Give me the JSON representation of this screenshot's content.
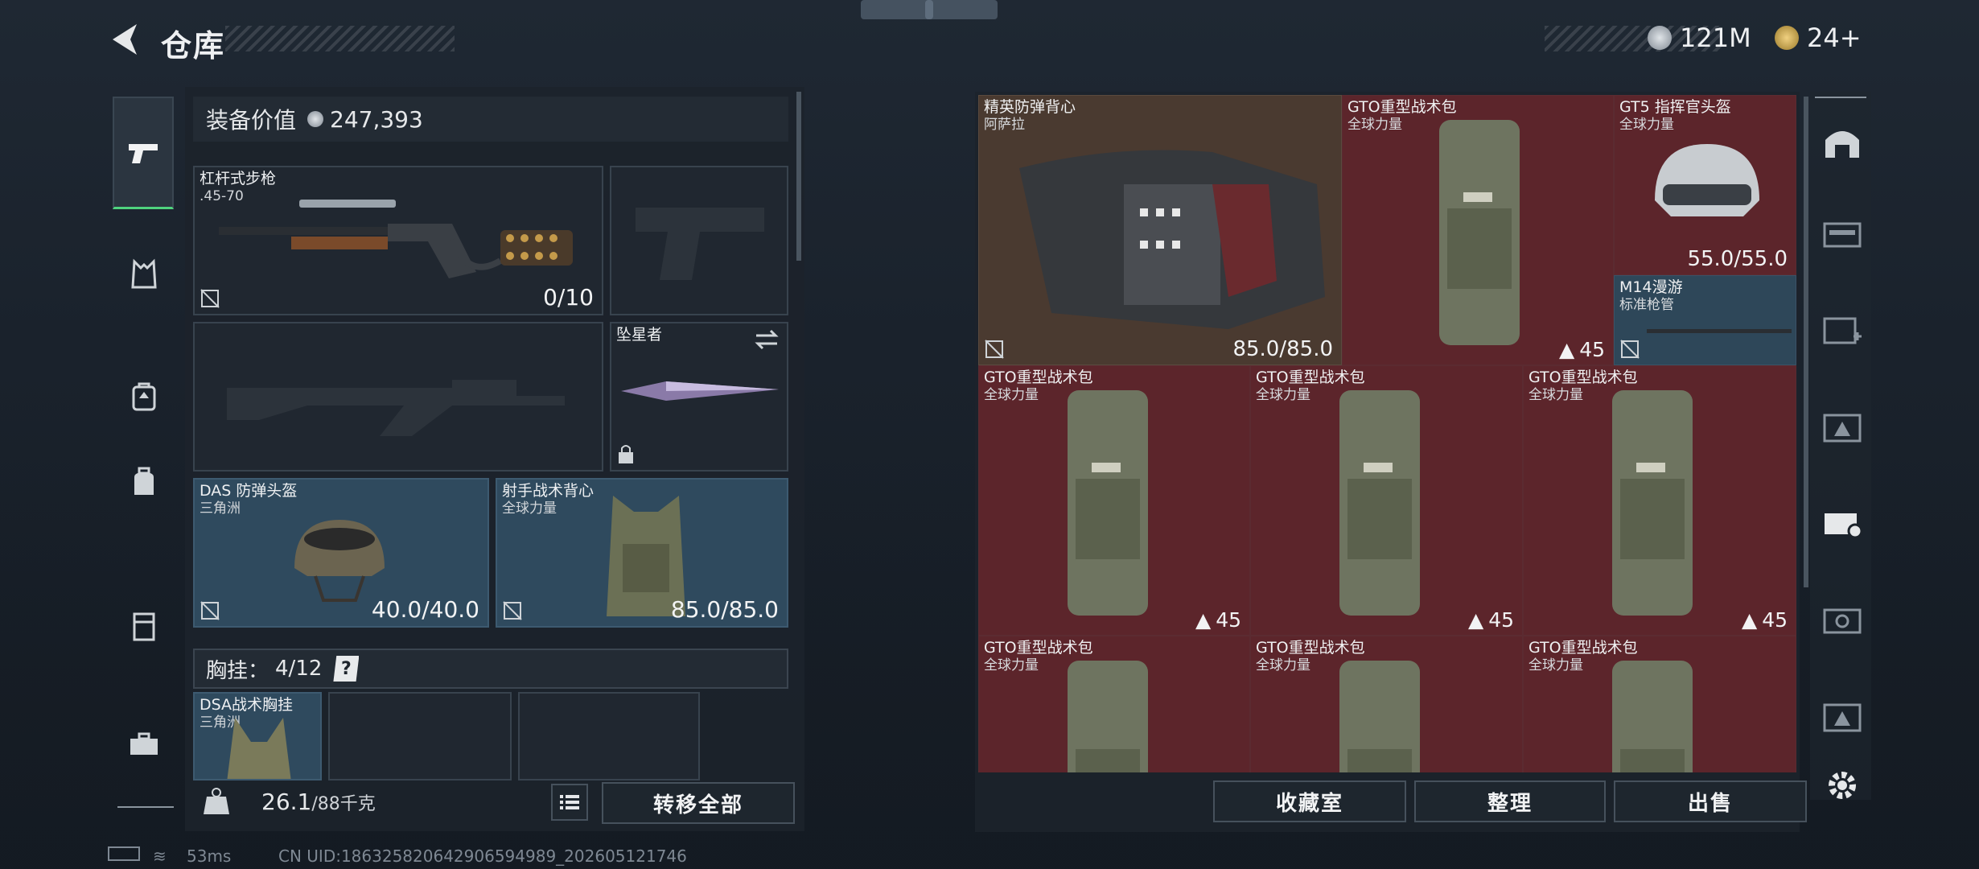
{
  "header": {
    "title": "仓库"
  },
  "currency": [
    {
      "value": "121M",
      "color": "#b8bfc7"
    },
    {
      "value": "24+",
      "color": "#c9a24a"
    }
  ],
  "left": {
    "equip_value_label": "装备价值",
    "equip_value": "247,393",
    "primary_weapon": {
      "name": "杠杆式步枪",
      "caliber": ".45-70",
      "ammo": "0/10"
    },
    "melee": {
      "name": "坠星者"
    },
    "helmet": {
      "name": "DAS 防弹头盔",
      "faction": "三角洲",
      "durability": "40.0/40.0"
    },
    "armor": {
      "name": "射手战术背心",
      "faction": "全球力量",
      "durability": "85.0/85.0"
    },
    "chest_rig_label": "胸挂：",
    "chest_rig_count": "4/12",
    "chest_rig_help": "?",
    "chest_rig": {
      "name": "DSA战术胸挂",
      "faction": "三角洲"
    },
    "weight": "26.1",
    "weight_cap": "/88千克",
    "transfer_all": "转移全部"
  },
  "stash": {
    "cells": [
      {
        "name": "精英防弹背心",
        "sub": "阿萨拉",
        "durability": "85.0/85.0"
      },
      {
        "name": "GTO重型战术包",
        "sub": "全球力量",
        "level": "45"
      },
      {
        "name": "GT5 指挥官头盔",
        "sub": "全球力量",
        "durability": "55.0/55.0"
      },
      {
        "name": "M14漫游",
        "sub": "标准枪管"
      },
      {
        "name": "GTO重型战术包",
        "sub": "全球力量",
        "level": "45"
      },
      {
        "name": "GTO重型战术包",
        "sub": "全球力量",
        "level": "45"
      },
      {
        "name": "GTO重型战术包",
        "sub": "全球力量",
        "level": "45"
      },
      {
        "name": "GTO重型战术包",
        "sub": "全球力量"
      },
      {
        "name": "GTO重型战术包",
        "sub": "全球力量"
      },
      {
        "name": "GTO重型战术包",
        "sub": "全球力量"
      }
    ],
    "buttons": {
      "collection": "收藏室",
      "organize": "整理",
      "sell": "出售"
    }
  },
  "status_bar": {
    "ping": "53ms",
    "uid": "CN UID:18632582064290659498​9_202605121746"
  },
  "icons": {
    "back": "back-arrow-icon",
    "pistol": "pistol-icon",
    "vest": "vest-icon",
    "backpack": "backpack-icon",
    "bag": "bag-icon",
    "locker": "locker-icon",
    "toolbox": "toolbox-icon",
    "settings": "gear-icon",
    "lock": "lock-icon",
    "swap": "swap-icon",
    "list": "list-icon",
    "weight": "weight-icon"
  }
}
